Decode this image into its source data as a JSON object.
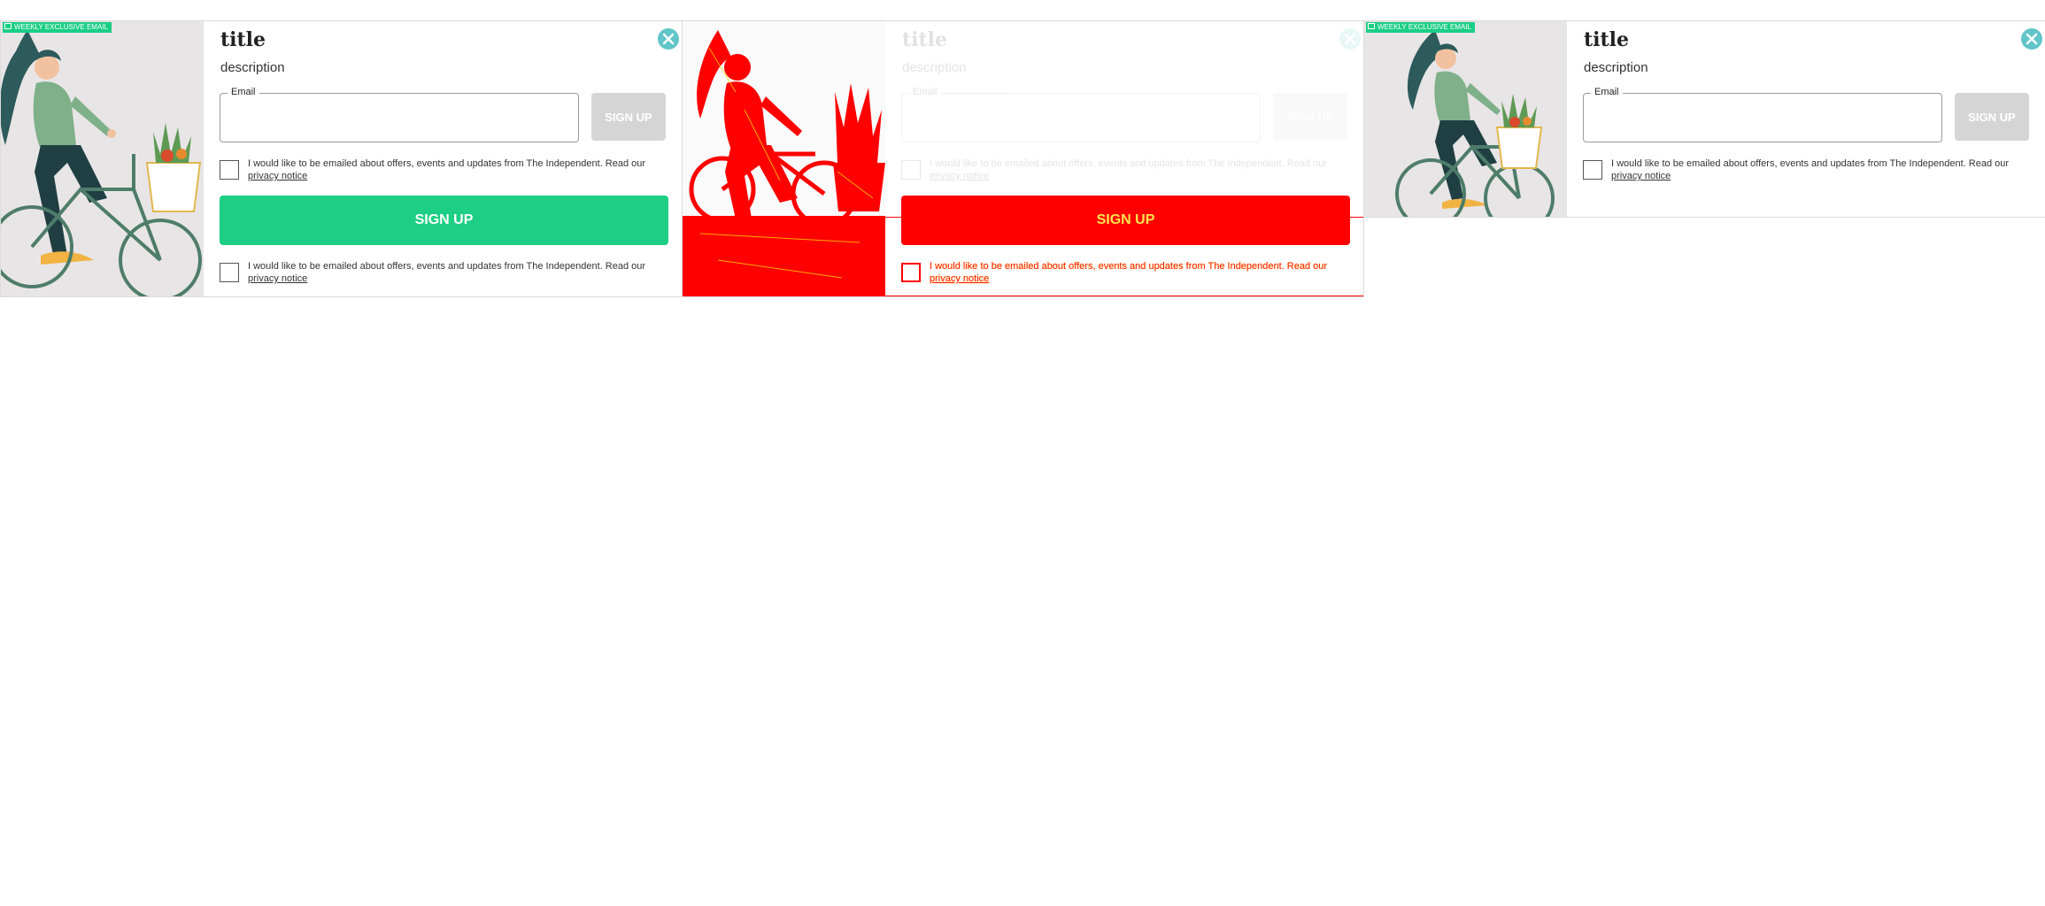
{
  "badge": "WEEKLY EXCLUSIVE EMAIL",
  "title": "title",
  "description": "description",
  "email_label": "Email",
  "email_value": "",
  "signup_small": "SIGN UP",
  "signup_big": "SIGN UP",
  "consent_text": "I would like to be emailed about offers, events and updates from The Independent. Read our ",
  "privacy_link": "privacy notice",
  "colors": {
    "accent": "#1dcf84",
    "disabled": "#d5d5d5",
    "debug_red": "#ff0000",
    "close": "#61c5c9"
  },
  "icons": [
    "close-icon",
    "email-icon",
    "bicycle-illustration"
  ]
}
